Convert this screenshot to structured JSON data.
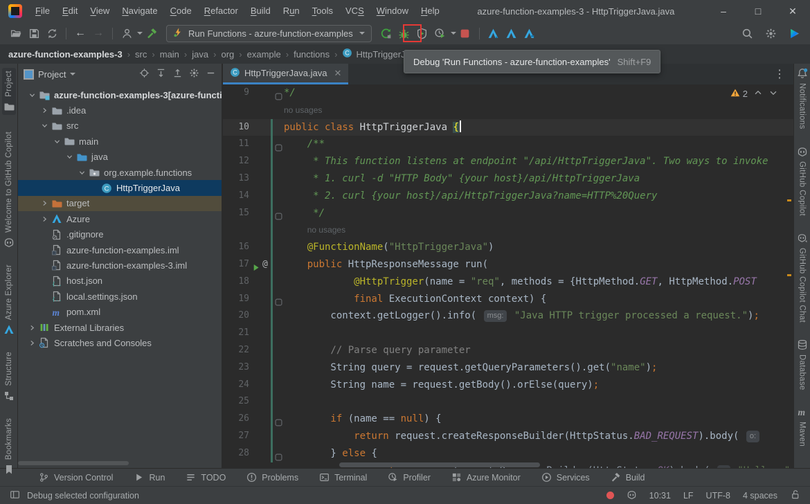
{
  "window": {
    "title": "azure-function-examples-3 - HttpTriggerJava.java",
    "menus": [
      {
        "label": "File",
        "u": 0
      },
      {
        "label": "Edit",
        "u": 0
      },
      {
        "label": "View",
        "u": 0
      },
      {
        "label": "Navigate",
        "u": 0
      },
      {
        "label": "Code",
        "u": 0
      },
      {
        "label": "Refactor",
        "u": 0
      },
      {
        "label": "Build",
        "u": 0
      },
      {
        "label": "Run",
        "u": 1
      },
      {
        "label": "Tools",
        "u": 0
      },
      {
        "label": "VCS",
        "u": 2
      },
      {
        "label": "Window",
        "u": 0
      },
      {
        "label": "Help",
        "u": 0
      }
    ],
    "controls": {
      "minimize": "–",
      "maximize": "□",
      "close": "✕"
    }
  },
  "toolbar": {
    "run_config": "Run Functions - azure-function-examples",
    "tooltip": {
      "text": "Debug 'Run Functions - azure-function-examples'",
      "shortcut": "Shift+F9"
    }
  },
  "breadcrumbs": [
    "azure-function-examples-3",
    "src",
    "main",
    "java",
    "org",
    "example",
    "functions",
    "HttpTriggerJava"
  ],
  "left_stripe": [
    {
      "label": "Project",
      "icon": "tool-project",
      "active": true
    },
    {
      "label": "Welcome to GitHub Copilot",
      "icon": "copilot"
    },
    {
      "label": "Azure Explorer",
      "icon": "azure"
    },
    {
      "label": "Structure",
      "icon": "structure"
    },
    {
      "label": "Bookmarks",
      "icon": "bookmarks"
    }
  ],
  "right_stripe": [
    {
      "label": "Notifications",
      "icon": "bell"
    },
    {
      "label": "GitHub Copilot",
      "icon": "copilot"
    },
    {
      "label": "GitHub Copilot Chat",
      "icon": "copilot-chat"
    },
    {
      "label": "Database",
      "icon": "database"
    },
    {
      "label": "Maven",
      "icon": "maven-gray"
    }
  ],
  "project_panel": {
    "title": "Project",
    "tree": [
      {
        "label": "azure-function-examples-3",
        "suffix": " [azure-functi",
        "depth": 0,
        "chevron": "down",
        "icon": "folder-root",
        "root": true
      },
      {
        "label": ".idea",
        "depth": 1,
        "chevron": "right",
        "icon": "folder"
      },
      {
        "label": "src",
        "depth": 1,
        "chevron": "down",
        "icon": "folder"
      },
      {
        "label": "main",
        "depth": 2,
        "chevron": "down",
        "icon": "folder"
      },
      {
        "label": "java",
        "depth": 3,
        "chevron": "down",
        "icon": "folder-src"
      },
      {
        "label": "org.example.functions",
        "depth": 4,
        "chevron": "down",
        "icon": "package"
      },
      {
        "label": "HttpTriggerJava",
        "depth": 5,
        "chevron": "none",
        "icon": "class",
        "selected": true
      },
      {
        "label": "target",
        "depth": 1,
        "chevron": "right",
        "icon": "folder-excluded",
        "highlight": true
      },
      {
        "label": "Azure",
        "depth": 1,
        "chevron": "right",
        "icon": "azure"
      },
      {
        "label": ".gitignore",
        "depth": 1,
        "chevron": "none",
        "icon": "file-ignored"
      },
      {
        "label": "azure-function-examples.iml",
        "depth": 1,
        "chevron": "none",
        "icon": "file-iml"
      },
      {
        "label": "azure-function-examples-3.iml",
        "depth": 1,
        "chevron": "none",
        "icon": "file-iml"
      },
      {
        "label": "host.json",
        "depth": 1,
        "chevron": "none",
        "icon": "file-json"
      },
      {
        "label": "local.settings.json",
        "depth": 1,
        "chevron": "none",
        "icon": "file-json"
      },
      {
        "label": "pom.xml",
        "depth": 1,
        "chevron": "none",
        "icon": "maven"
      },
      {
        "label": "External Libraries",
        "depth": 0,
        "chevron": "right",
        "icon": "libraries"
      },
      {
        "label": "Scratches and Consoles",
        "depth": 0,
        "chevron": "right",
        "icon": "scratches"
      }
    ]
  },
  "editor": {
    "tab": "HttpTriggerJava.java",
    "warning_count": "2",
    "lines": [
      {
        "n": "9",
        "fold": true,
        "seg": [
          [
            "c",
            "*/"
          ]
        ]
      },
      {
        "inlay": "no usages",
        "ind": 0
      },
      {
        "n": "10",
        "cur": true,
        "vcs": true,
        "seg": [
          [
            "k",
            "public class "
          ],
          [
            "t",
            "HttpTriggerJava "
          ],
          [
            "b",
            "{"
          ],
          [
            "caret",
            ""
          ]
        ]
      },
      {
        "n": "11",
        "fold": true,
        "vcs": true,
        "seg": [
          [
            "c",
            "    /**"
          ]
        ]
      },
      {
        "n": "12",
        "vcs": true,
        "seg": [
          [
            "c",
            "     * This function listens at endpoint \"/api/HttpTriggerJava\". Two ways to invoke"
          ]
        ]
      },
      {
        "n": "13",
        "vcs": true,
        "seg": [
          [
            "c",
            "     * 1. curl -d \"HTTP Body\" {your host}/api/HttpTriggerJava"
          ]
        ]
      },
      {
        "n": "14",
        "vcs": true,
        "seg": [
          [
            "c",
            "     * 2. curl {your host}/api/HttpTriggerJava?name=HTTP%20Query"
          ]
        ]
      },
      {
        "n": "15",
        "fold": true,
        "vcs": true,
        "seg": [
          [
            "c",
            "     */"
          ]
        ]
      },
      {
        "inlay": "no usages",
        "ind": 4,
        "vcs": true
      },
      {
        "n": "16",
        "vcs": true,
        "seg": [
          [
            "a",
            "    @FunctionName"
          ],
          [
            "p",
            "("
          ],
          [
            "s",
            "\"HttpTriggerJava\""
          ],
          [
            "p",
            ")"
          ]
        ]
      },
      {
        "n": "17",
        "run": true,
        "vcs": true,
        "seg": [
          [
            "k",
            "    public "
          ],
          [
            "p",
            "HttpResponseMessage run("
          ]
        ]
      },
      {
        "n": "18",
        "vcs": true,
        "seg": [
          [
            "a",
            "            @HttpTrigger"
          ],
          [
            "p",
            "(name = "
          ],
          [
            "s",
            "\"req\""
          ],
          [
            "p",
            ", methods = {HttpMethod."
          ],
          [
            "n",
            "GET"
          ],
          [
            "p",
            ", HttpMethod."
          ],
          [
            "n",
            "POST"
          ]
        ]
      },
      {
        "n": "19",
        "fold": true,
        "vcs": true,
        "seg": [
          [
            "k",
            "            final "
          ],
          [
            "p",
            "ExecutionContext context) {"
          ]
        ]
      },
      {
        "n": "20",
        "vcs": true,
        "seg": [
          [
            "p",
            "        context.getLogger().info( "
          ],
          [
            "ch",
            "msg:"
          ],
          [
            "s",
            " \"Java HTTP trigger processed a request.\""
          ],
          [
            "p",
            ")"
          ],
          [
            "k",
            ";"
          ]
        ]
      },
      {
        "n": "21",
        "vcs": true,
        "seg": []
      },
      {
        "n": "22",
        "vcs": true,
        "seg": [
          [
            "lc",
            "        // Parse query parameter"
          ]
        ]
      },
      {
        "n": "23",
        "vcs": true,
        "seg": [
          [
            "p",
            "        String query = request.getQueryParameters().get("
          ],
          [
            "s",
            "\"name\""
          ],
          [
            "p",
            ")"
          ],
          [
            "k",
            ";"
          ]
        ]
      },
      {
        "n": "24",
        "vcs": true,
        "seg": [
          [
            "p",
            "        String name = request.getBody().orElse(query)"
          ],
          [
            "k",
            ";"
          ]
        ]
      },
      {
        "n": "25",
        "vcs": true,
        "seg": []
      },
      {
        "n": "26",
        "fold": true,
        "vcs": true,
        "seg": [
          [
            "k",
            "        if "
          ],
          [
            "p",
            "(name == "
          ],
          [
            "k",
            "null"
          ],
          [
            "p",
            ") {"
          ]
        ]
      },
      {
        "n": "27",
        "vcs": true,
        "seg": [
          [
            "k",
            "            return "
          ],
          [
            "p",
            "request.createResponseBuilder(HttpStatus."
          ],
          [
            "n",
            "BAD_REQUEST"
          ],
          [
            "p",
            ").body( "
          ],
          [
            "ch",
            "o:"
          ]
        ]
      },
      {
        "n": "28",
        "fold": true,
        "vcs": true,
        "seg": [
          [
            "p",
            "        } "
          ],
          [
            "k",
            "else"
          ],
          [
            "p",
            " {"
          ]
        ]
      },
      {
        "partial": true,
        "seg": [
          [
            "k",
            "                return "
          ],
          [
            "p",
            "request.createResponseBuilder(HttpStatus."
          ],
          [
            "n",
            "OK"
          ],
          [
            "p",
            ").body( "
          ],
          [
            "ch",
            "o:"
          ],
          [
            "s",
            " \"Hello, \""
          ]
        ]
      }
    ]
  },
  "bottom_bar": [
    {
      "label": "Version Control",
      "icon": "branch"
    },
    {
      "label": "Run",
      "icon": "play"
    },
    {
      "label": "TODO",
      "icon": "todo"
    },
    {
      "label": "Problems",
      "icon": "problems"
    },
    {
      "label": "Terminal",
      "icon": "terminal"
    },
    {
      "label": "Profiler",
      "icon": "profiler-gray"
    },
    {
      "label": "Azure Monitor",
      "icon": "azure-monitor"
    },
    {
      "label": "Services",
      "icon": "services"
    },
    {
      "label": "Build",
      "icon": "hammer-gray"
    }
  ],
  "status_bar": {
    "message": "Debug selected configuration",
    "caret_position": "10:31",
    "line_ending": "LF",
    "encoding": "UTF-8",
    "indent": "4 spaces"
  }
}
